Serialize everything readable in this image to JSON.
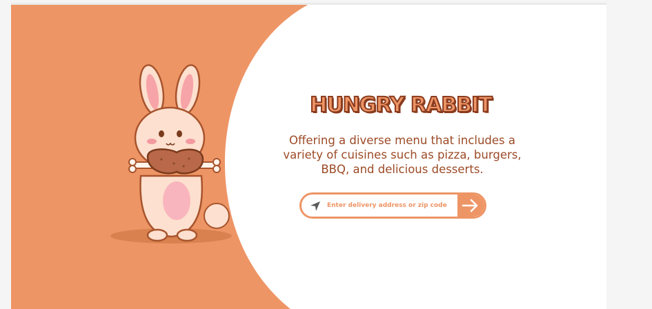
{
  "hero": {
    "title": "HUNGRY RABBIT",
    "tagline": "Offering a diverse menu that includes a variety of cuisines such as pizza, burgers, BBQ, and delicious desserts.",
    "illustration": "rabbit-holding-drumstick-illustration"
  },
  "search": {
    "placeholder": "Enter delivery address or zip code",
    "value": "",
    "leading_icon": "navigation-arrow-icon",
    "submit_icon": "arrow-right-icon"
  },
  "colors": {
    "accent": "#EE9566",
    "title_outline": "#8A3B1E",
    "text": "#9C4A26",
    "background": "#FFFFFF"
  }
}
